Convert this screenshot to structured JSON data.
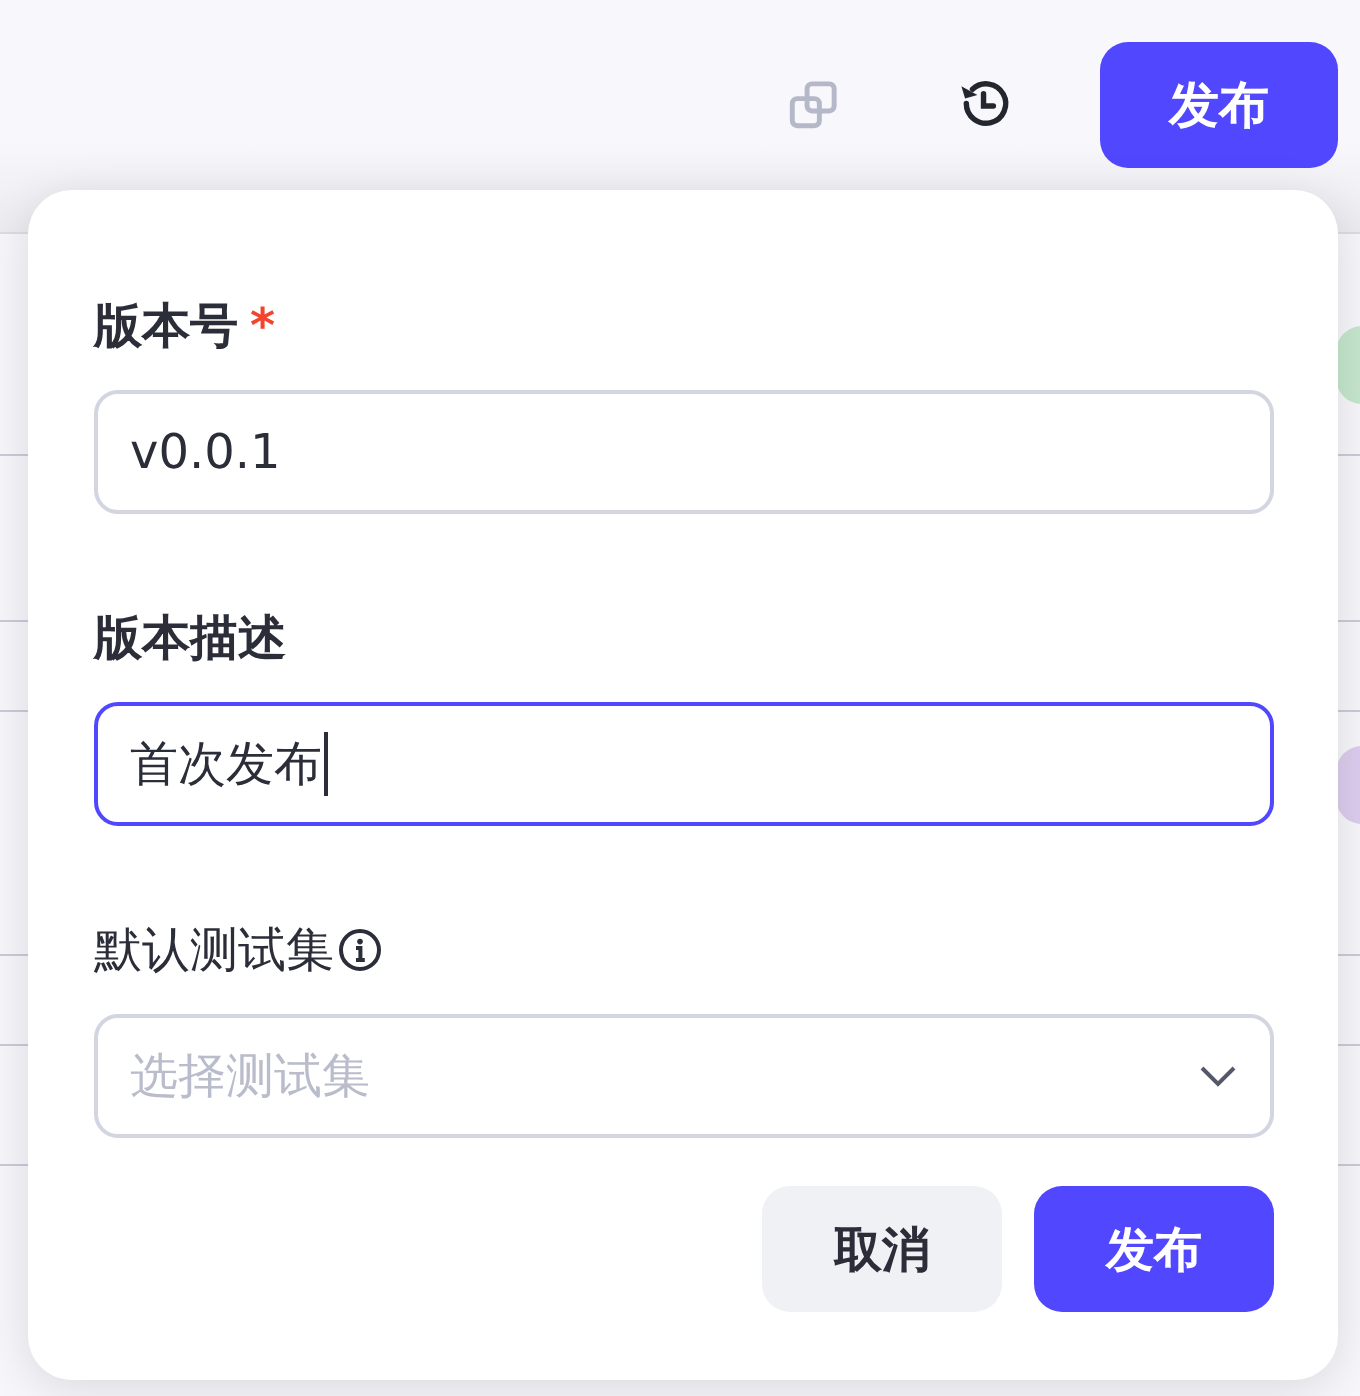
{
  "toolbar": {
    "icons": [
      {
        "kind": "copy",
        "disabled": true
      },
      {
        "kind": "history",
        "disabled": false
      }
    ],
    "publish_button": "发布"
  },
  "popover": {
    "fields": [
      {
        "kind": "input",
        "label": "版本号",
        "required_mark": "*",
        "value": "v0.0.1",
        "focused": false
      },
      {
        "kind": "input",
        "label": "版本描述",
        "value": "首次发布",
        "focused": true
      },
      {
        "kind": "select",
        "label": "默认测试集",
        "info": true,
        "placeholder": "选择测试集",
        "focused": false
      }
    ],
    "buttons": [
      {
        "label": "取消",
        "kind": "secondary"
      },
      {
        "label": "发布",
        "kind": "primary"
      }
    ]
  }
}
